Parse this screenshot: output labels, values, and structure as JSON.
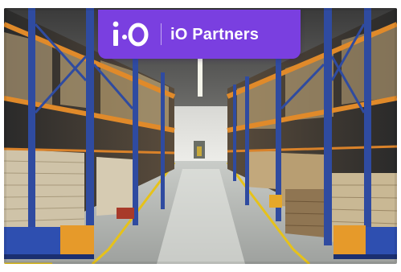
{
  "brand": {
    "logo_text": "i·O",
    "name": "iO Partners",
    "accent_color": "#7A3FE0"
  },
  "photo": {
    "subject_icon": "warehouse-photo"
  }
}
